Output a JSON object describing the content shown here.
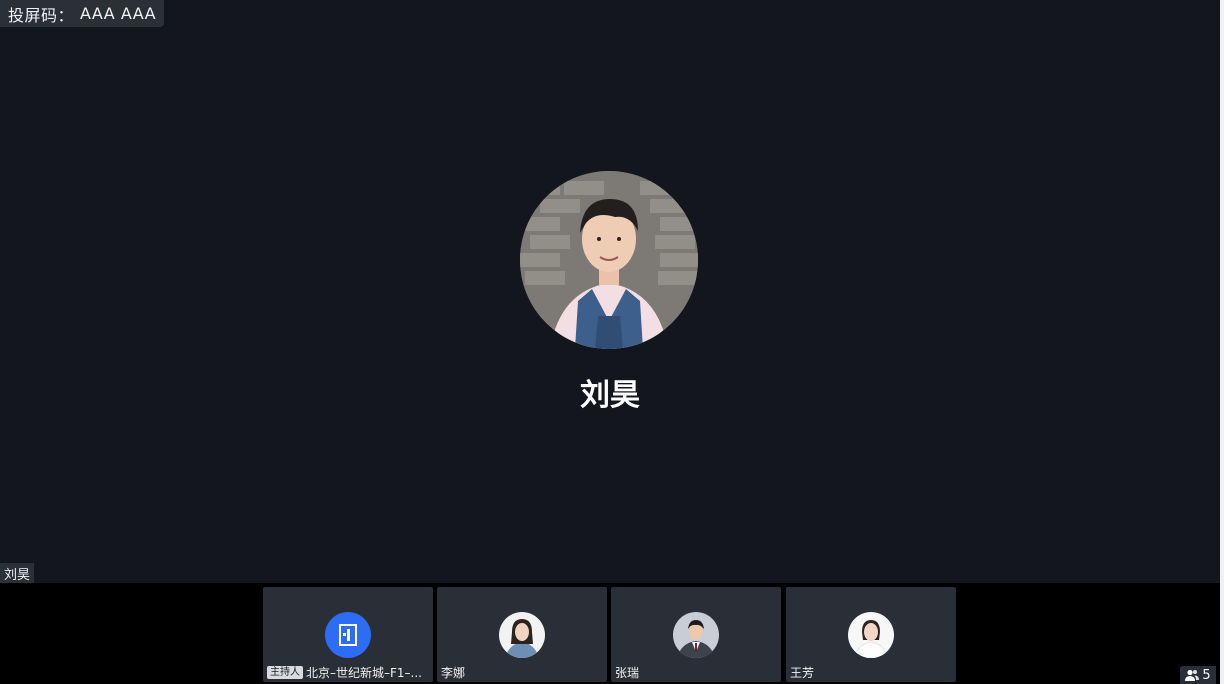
{
  "cast": {
    "label": "投屏码：",
    "code": "AAA AAA"
  },
  "speaker": {
    "name": "刘昊",
    "tag": "刘昊"
  },
  "participants": [
    {
      "host_badge": "主持人",
      "name": "北京–世纪新城–F1–...",
      "avatar": "meeting-room-icon"
    },
    {
      "name": "李娜",
      "avatar": "woman-avatar"
    },
    {
      "name": "张瑞",
      "avatar": "man-avatar"
    },
    {
      "name": "王芳",
      "avatar": "woman-avatar"
    }
  ],
  "participant_count": "5",
  "colors": {
    "stage": "#13161c",
    "tile": "#2a2e36",
    "room_avatar": "#2d6df6"
  }
}
